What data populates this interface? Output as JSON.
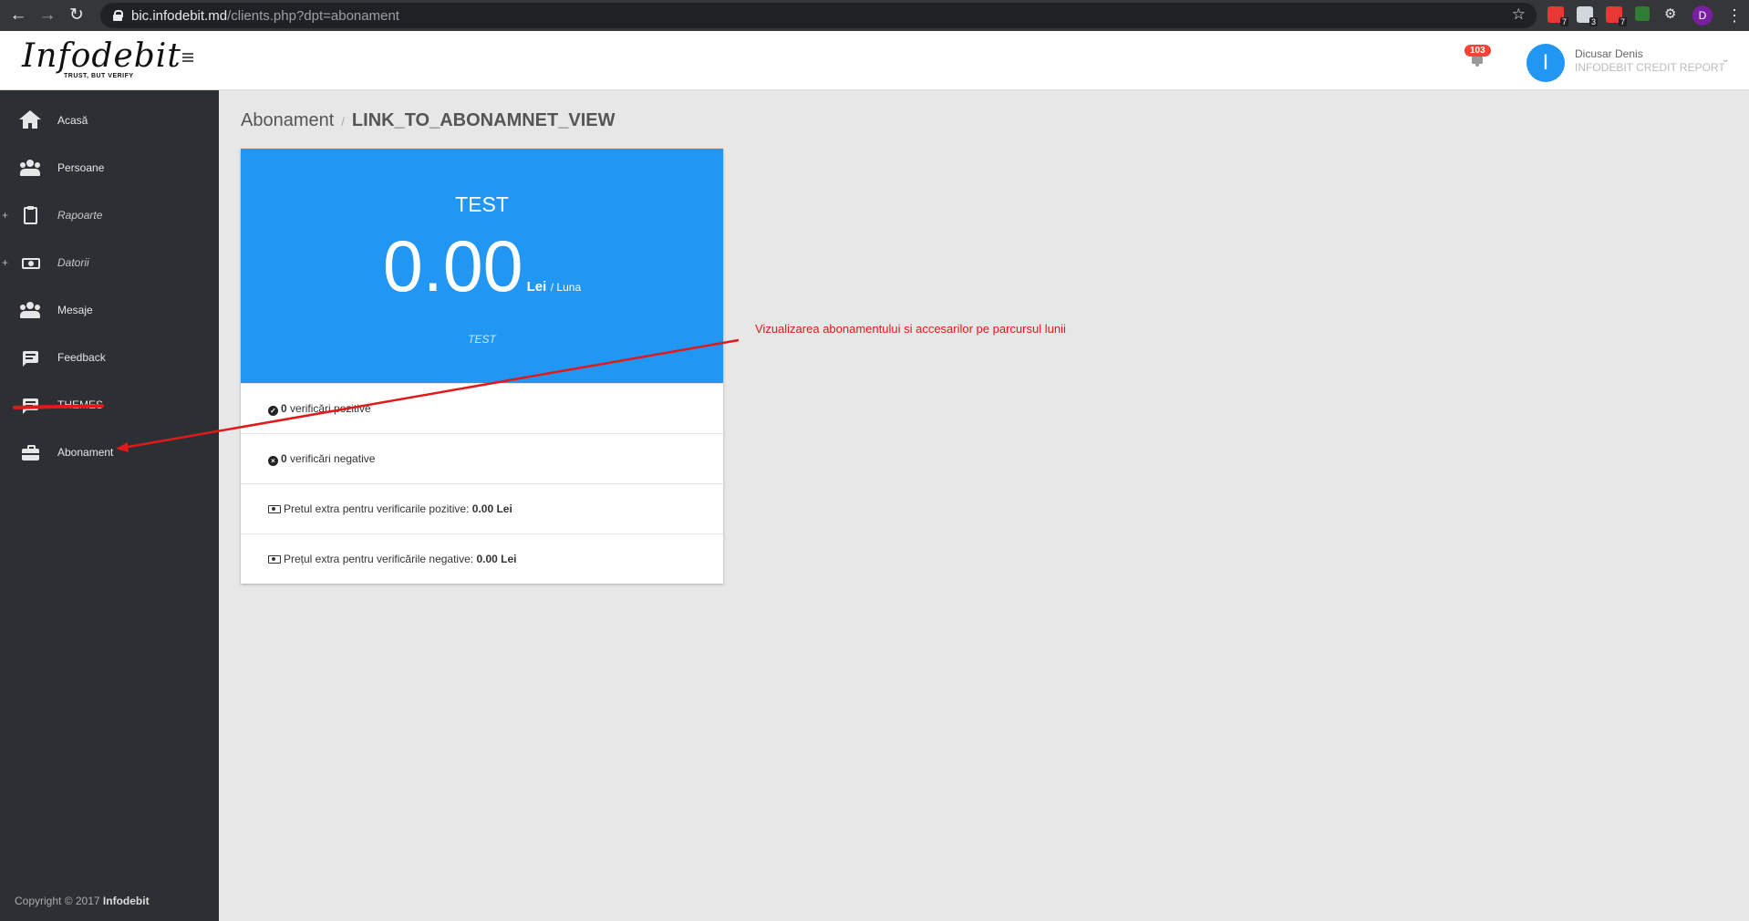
{
  "browser": {
    "url_host": "bic.infodebit.md",
    "url_path": "/clients.php?dpt=abonament",
    "extension_badges": [
      "7",
      "3",
      "7"
    ],
    "profile_initial": "D"
  },
  "header": {
    "logo_text": "Infodebit",
    "logo_tagline": "TRUST, BUT VERIFY",
    "notification_count": "103",
    "user_initial": "I",
    "user_name": "Dicusar Denis",
    "user_role": "INFODEBIT CREDIT REPORT"
  },
  "sidebar": {
    "items": [
      {
        "label": "Acasă",
        "icon": "home-icon"
      },
      {
        "label": "Persoane",
        "icon": "people-icon"
      },
      {
        "label": "Rapoarte",
        "icon": "clipboard-icon"
      },
      {
        "label": "Datorii",
        "icon": "money-icon"
      },
      {
        "label": "Mesaje",
        "icon": "people-icon"
      },
      {
        "label": "Feedback",
        "icon": "chat-icon"
      },
      {
        "label": "THEMES",
        "icon": "chat-icon"
      },
      {
        "label": "Abonament",
        "icon": "briefcase-icon"
      }
    ],
    "copyright_prefix": "Copyright © 2017",
    "copyright_brand": "Infodebit"
  },
  "breadcrumb": {
    "parent": "Abonament",
    "current": "LINK_TO_ABONAMNET_VIEW"
  },
  "plan": {
    "name": "TEST",
    "price": "0.00",
    "currency": "Lei",
    "period": "/ Luna",
    "description": "TEST",
    "positive_count": "0",
    "positive_label": "verificări pozitive",
    "negative_count": "0",
    "negative_label": "verificări negative",
    "extra_positive_label": "Pretul extra pentru verificarile pozitive:",
    "extra_positive_value": "0.00 Lei",
    "extra_negative_label": "Prețul extra pentru verificările negative:",
    "extra_negative_value": "0.00 Lei"
  },
  "annotation": {
    "text": "Vizualizarea abonamentului si accesarilor pe parcursul lunii",
    "color": "#e11919"
  },
  "colors": {
    "accent": "#2196f3",
    "sidebar_bg": "#2c2f33",
    "badge": "#f44336"
  }
}
